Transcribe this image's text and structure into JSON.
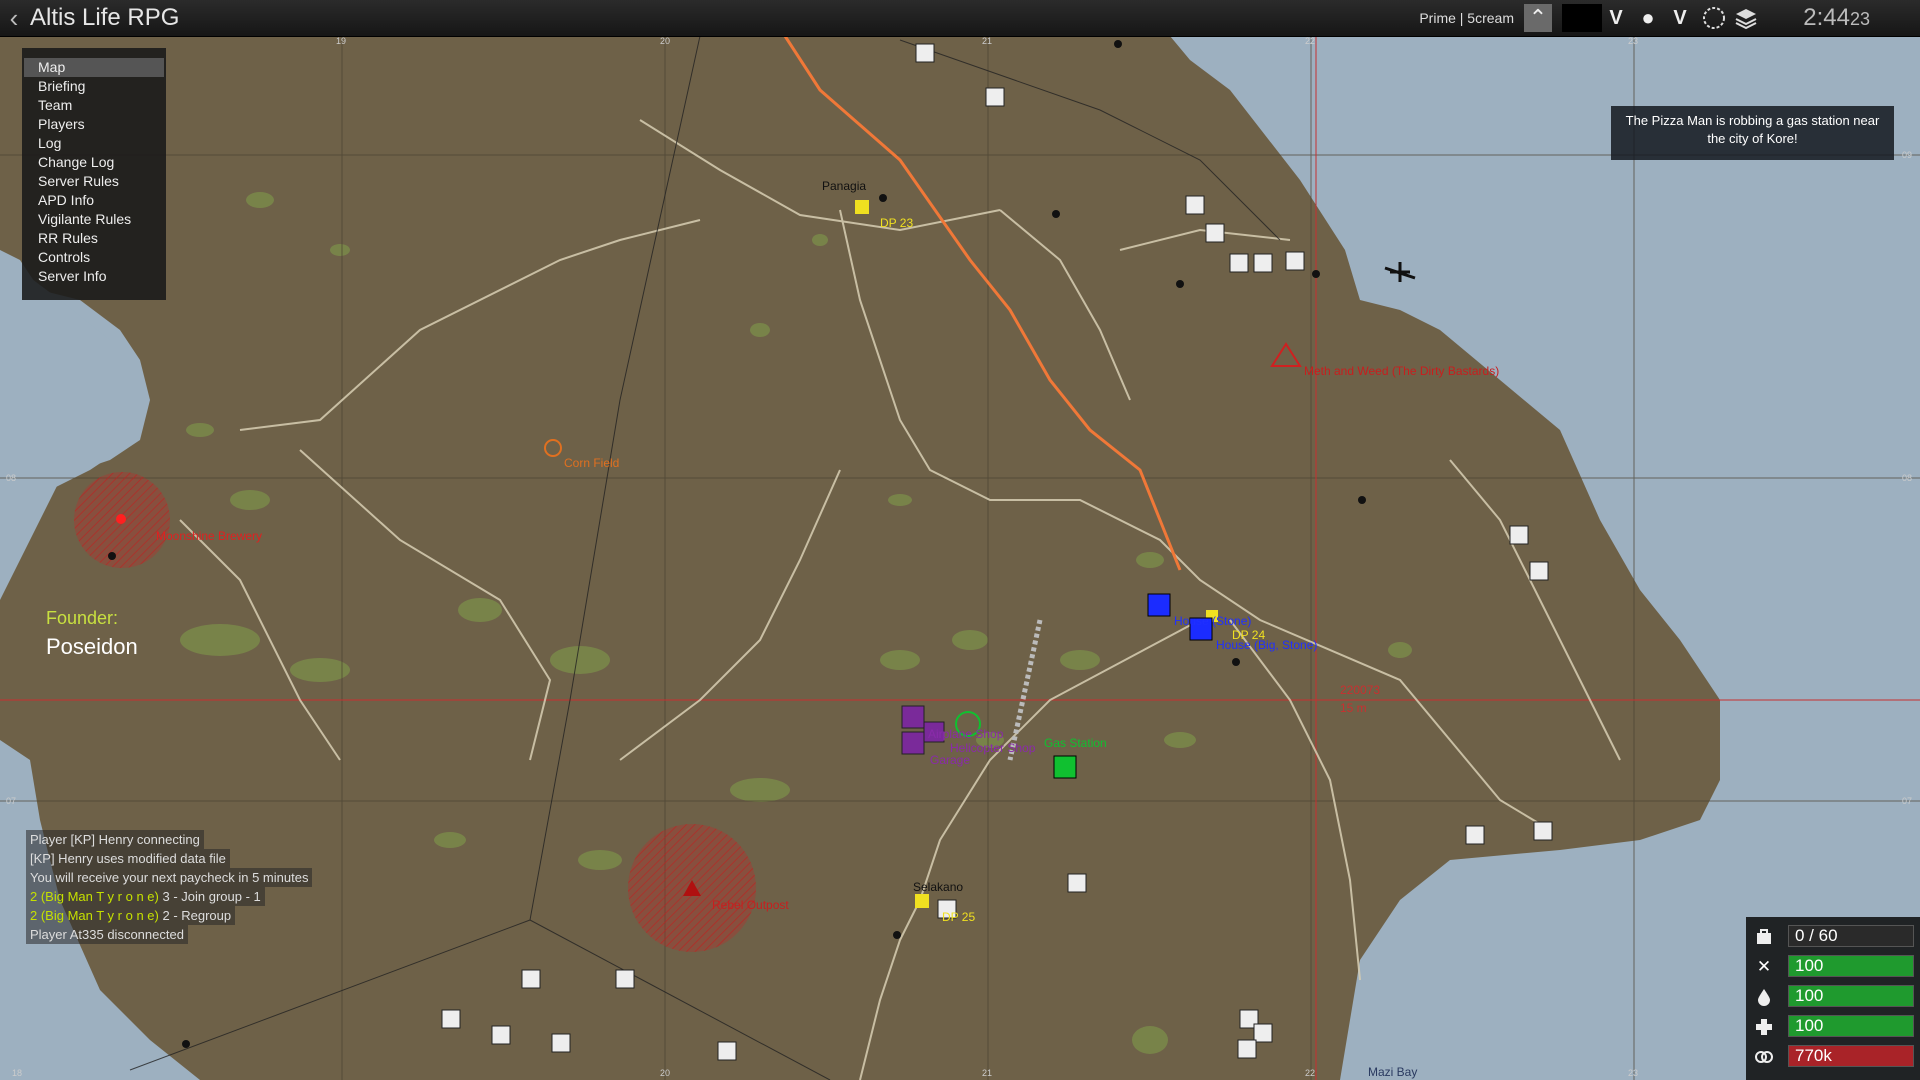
{
  "window": {
    "title": "Altis Life RPG"
  },
  "topbar": {
    "server_label": "Prime | 5cream",
    "clock_main": "2:44",
    "clock_seconds": "23",
    "v1": "V",
    "v2": "V"
  },
  "menu": {
    "items": [
      {
        "label": "Map"
      },
      {
        "label": "Briefing"
      },
      {
        "label": "Team"
      },
      {
        "label": "Players"
      },
      {
        "label": "Log"
      },
      {
        "label": "Change Log"
      },
      {
        "label": "Server Rules"
      },
      {
        "label": "APD Info"
      },
      {
        "label": "Vigilante Rules"
      },
      {
        "label": "RR Rules"
      },
      {
        "label": "Controls"
      },
      {
        "label": "Server Info"
      }
    ]
  },
  "notice": {
    "text": "The Pizza Man is robbing a gas station near the city of Kore!"
  },
  "founder": {
    "label": "Founder:",
    "name": "Poseidon"
  },
  "chat": {
    "lines": [
      {
        "text": "Player [KP] Henry connecting"
      },
      {
        "text": "[KP] Henry uses modified data file"
      },
      {
        "text": "You will receive your next paycheck in 5 minutes"
      },
      {
        "name": "2 (Big Man T y r o n e)",
        "msg": " 3 - Join group - 1"
      },
      {
        "name": "2 (Big Man T y r o n e)",
        "msg": " 2 - Regroup"
      },
      {
        "text": "Player At335 disconnected"
      }
    ]
  },
  "status": {
    "inventory": "0 / 60",
    "food": "100",
    "water": "100",
    "health": "100",
    "money": "770k"
  },
  "map": {
    "colors": {
      "terrain": "#6e6148",
      "sea": "#9db0c0",
      "road": "#d8cfb4",
      "route": "#f07838"
    },
    "labels": {
      "panagia": "Panagia",
      "dp23": "DP 23",
      "selakano": "Selakano",
      "dp25": "DP 25",
      "dp24": "DP 24",
      "corn": "Corn Field",
      "moonshine": "Moonshine Brewery",
      "meth": "Meth and Weed (The Dirty Bastards)",
      "rebel": "Rebel Outpost",
      "house_stone": "House (Stone)",
      "house_big": "House (Big, Stone)",
      "airplane": "Airplane Shop",
      "heli": "Helicopter Shop",
      "garage": "Garage",
      "gas_station": "Gas Station",
      "grid_ref": "220073",
      "distance": "15 m",
      "mazi": "Mazi Bay"
    },
    "grid": {
      "top": [
        "19",
        "20",
        "21",
        "22",
        "23"
      ],
      "left": [
        "08",
        "07"
      ],
      "right": [
        "09",
        "08",
        "07"
      ],
      "bottom": [
        "18",
        "20",
        "21",
        "22",
        "23"
      ]
    }
  }
}
